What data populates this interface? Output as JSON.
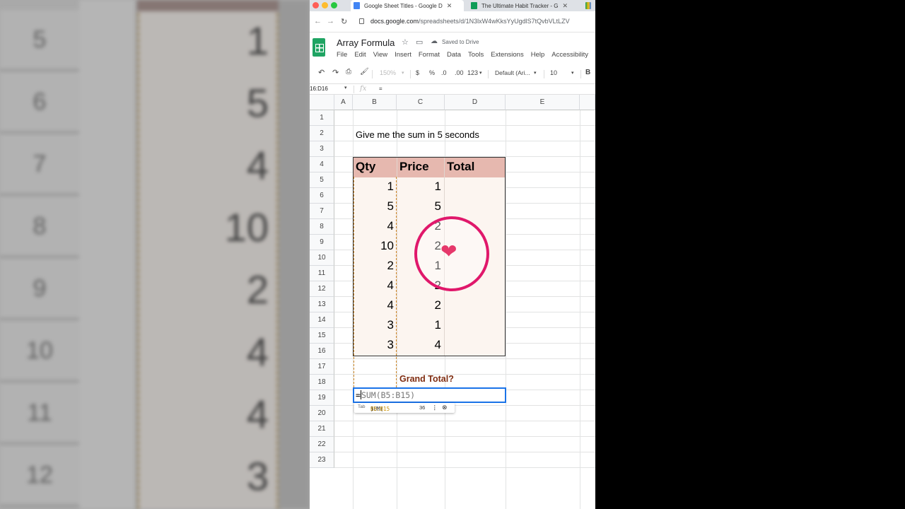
{
  "browser": {
    "tabs": [
      {
        "title": "Google Sheet Titles - Google D",
        "favicon_color": "#4285f4"
      },
      {
        "title": "The Ultimate Habit Tracker - G",
        "favicon_color": "#0f9d58"
      }
    ],
    "url_host": "docs.google.com",
    "url_path": "/spreadsheets/d/1N3lxW4wKksYyUgdlS7tQvbVLtLZV"
  },
  "doc": {
    "title": "Array Formula",
    "saved_status": "Saved to Drive",
    "menu": [
      "File",
      "Edit",
      "View",
      "Insert",
      "Format",
      "Data",
      "Tools",
      "Extensions",
      "Help",
      "Accessibility"
    ]
  },
  "toolbar": {
    "zoom": "150%",
    "currency": "$",
    "percent": "%",
    "dec_decrease": ".0",
    "dec_increase": ".00",
    "number_format": "123",
    "font": "Default (Ari...",
    "font_size": "10",
    "bold": "B"
  },
  "formula_bar": {
    "name_box": "16:D16",
    "fx": "fx",
    "content": "="
  },
  "columns": [
    "A",
    "B",
    "C",
    "D",
    "E"
  ],
  "rows": [
    "1",
    "2",
    "3",
    "4",
    "5",
    "6",
    "7",
    "8",
    "9",
    "10",
    "11",
    "12",
    "13",
    "14",
    "15",
    "16",
    "17",
    "18",
    "19",
    "20",
    "21",
    "22",
    "23"
  ],
  "sheet": {
    "prompt": "Give me the sum in 5 seconds",
    "headers": [
      "Qty",
      "Price",
      "Total"
    ],
    "qty": [
      "1",
      "5",
      "4",
      "10",
      "2",
      "4",
      "4",
      "3",
      "3"
    ],
    "price": [
      "1",
      "5",
      "2",
      "2",
      "1",
      "2",
      "2",
      "1",
      "4"
    ],
    "grand_total_label": "Grand Total?",
    "editing_formula_eq": "=",
    "editing_formula_rest": "SUM(B5:B15)",
    "suggestion": {
      "tab_hint": "Tab",
      "fn_start": "SUM(",
      "fn_range": "B5:B15",
      "fn_end": ")",
      "result": "36"
    }
  },
  "zoom_panel": {
    "row_numbers": [
      "5",
      "6",
      "7",
      "8",
      "9",
      "10",
      "11",
      "12"
    ],
    "values": [
      "1",
      "5",
      "4",
      "10",
      "2",
      "4",
      "4",
      "3"
    ]
  },
  "colors": {
    "header_fill": "#e6b8af",
    "table_fill": "#fcf5f0",
    "grand_total_text": "#7f2c10",
    "active_cell_border": "#1a73e8",
    "highlight_ring": "#e0186b"
  },
  "icons": [
    "undo-icon",
    "redo-icon",
    "print-icon",
    "paint-format-icon",
    "star-icon",
    "move-folder-icon",
    "cloud-icon",
    "heart-icon"
  ]
}
